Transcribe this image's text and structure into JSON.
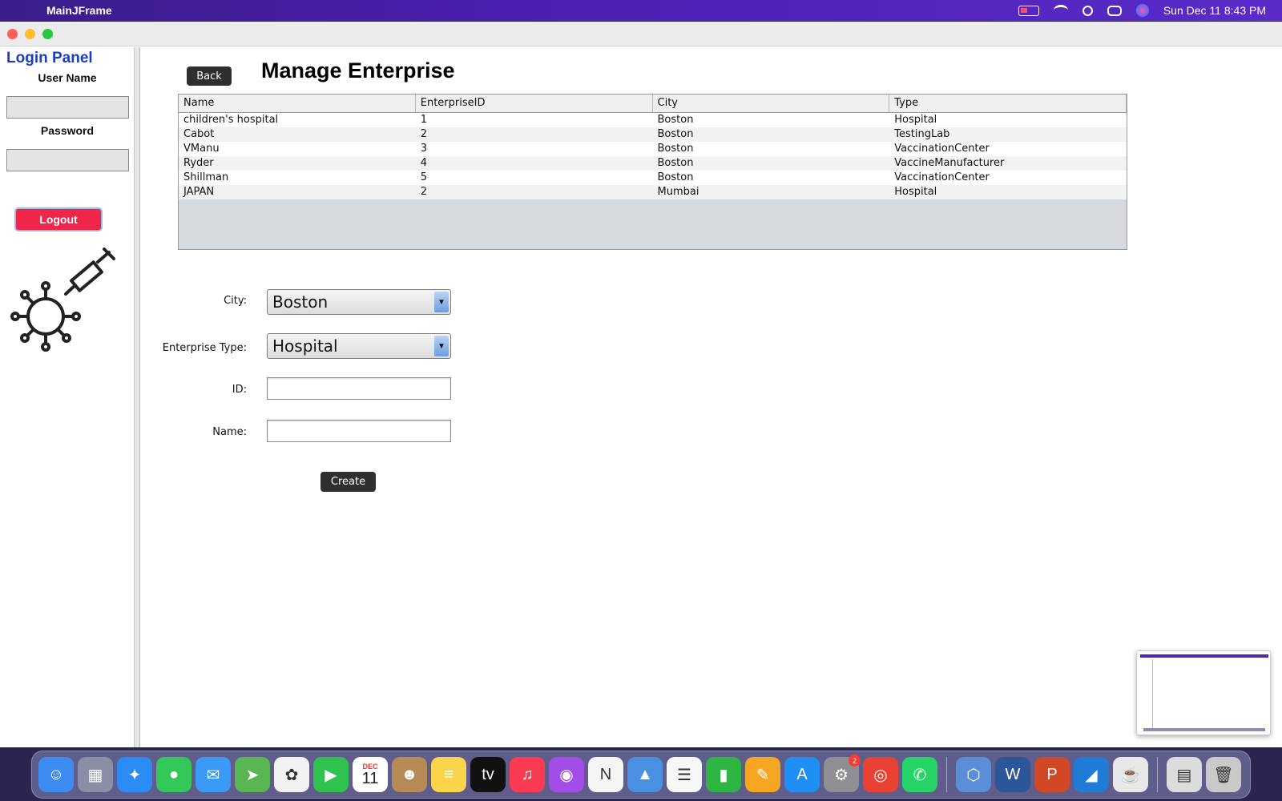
{
  "menubar": {
    "app_name": "MainJFrame",
    "datetime": "Sun Dec 11  8:43 PM"
  },
  "left_panel": {
    "title": "Login Panel",
    "username_label": "User Name",
    "password_label": "Password",
    "username_value": "",
    "password_value": "",
    "logout_label": "Logout"
  },
  "main": {
    "back_label": "Back",
    "title": "Manage Enterprise",
    "table": {
      "columns": [
        "Name",
        "EnterpriseID",
        "City",
        "Type"
      ],
      "rows": [
        [
          "children's hospital",
          "1",
          "Boston",
          "Hospital"
        ],
        [
          "Cabot",
          "2",
          "Boston",
          "TestingLab"
        ],
        [
          "VManu",
          "3",
          "Boston",
          "VaccinationCenter"
        ],
        [
          "Ryder",
          "4",
          "Boston",
          "VaccineManufacturer"
        ],
        [
          "Shillman",
          "5",
          "Boston",
          "VaccinationCenter"
        ],
        [
          "JAPAN",
          "2",
          "Mumbai",
          "Hospital"
        ]
      ]
    },
    "form": {
      "city_label": "City:",
      "city_value": "Boston",
      "type_label": "Enterprise Type:",
      "type_value": "Hospital",
      "id_label": "ID:",
      "id_value": "",
      "name_label": "Name:",
      "name_value": "",
      "create_label": "Create"
    }
  },
  "dock": {
    "calendar_month": "DEC",
    "calendar_day": "11",
    "settings_badge": "2",
    "apps": [
      {
        "name": "finder",
        "color": "#3d8cf2",
        "glyph": "☺"
      },
      {
        "name": "launchpad",
        "color": "#8a8fa6",
        "glyph": "▦"
      },
      {
        "name": "safari",
        "color": "#2b8cf5",
        "glyph": "✦"
      },
      {
        "name": "messages",
        "color": "#34c759",
        "glyph": "●"
      },
      {
        "name": "mail",
        "color": "#3a9af5",
        "glyph": "✉"
      },
      {
        "name": "maps",
        "color": "#59b653",
        "glyph": "➤"
      },
      {
        "name": "photos",
        "color": "#f2f2f2",
        "glyph": "✿"
      },
      {
        "name": "facetime",
        "color": "#2fc24e",
        "glyph": "▶"
      },
      {
        "name": "calendar",
        "color": "#ffffff",
        "glyph": ""
      },
      {
        "name": "contacts",
        "color": "#b58a55",
        "glyph": "☻"
      },
      {
        "name": "notes",
        "color": "#fad44b",
        "glyph": "≡"
      },
      {
        "name": "tv",
        "color": "#111111",
        "glyph": "tv"
      },
      {
        "name": "music",
        "color": "#fa3b52",
        "glyph": "♫"
      },
      {
        "name": "podcasts",
        "color": "#a24de8",
        "glyph": "◉"
      },
      {
        "name": "news",
        "color": "#f5f5f5",
        "glyph": "N"
      },
      {
        "name": "keynote",
        "color": "#4a90e2",
        "glyph": "▲"
      },
      {
        "name": "reminders",
        "color": "#f7f7f7",
        "glyph": "☰"
      },
      {
        "name": "numbers",
        "color": "#2fb544",
        "glyph": "▮"
      },
      {
        "name": "pages",
        "color": "#f5a623",
        "glyph": "✎"
      },
      {
        "name": "app-store",
        "color": "#1f8ff5",
        "glyph": "A"
      },
      {
        "name": "system-preferences",
        "color": "#8e8e93",
        "glyph": "⚙"
      },
      {
        "name": "chrome",
        "color": "#e94235",
        "glyph": "◎"
      },
      {
        "name": "whatsapp",
        "color": "#25d366",
        "glyph": "✆"
      }
    ],
    "apps2": [
      {
        "name": "netbeans",
        "color": "#5a8ed6",
        "glyph": "⬡"
      },
      {
        "name": "word",
        "color": "#2b579a",
        "glyph": "W"
      },
      {
        "name": "powerpoint",
        "color": "#d24726",
        "glyph": "P"
      },
      {
        "name": "vscode",
        "color": "#1f7bd6",
        "glyph": "◢"
      },
      {
        "name": "java",
        "color": "#e8e8e8",
        "glyph": "☕"
      }
    ],
    "apps3": [
      {
        "name": "screenshot-stack",
        "color": "#dcdcdc",
        "glyph": "▤"
      },
      {
        "name": "trash",
        "color": "#c9c9c9",
        "glyph": "🗑"
      }
    ]
  }
}
